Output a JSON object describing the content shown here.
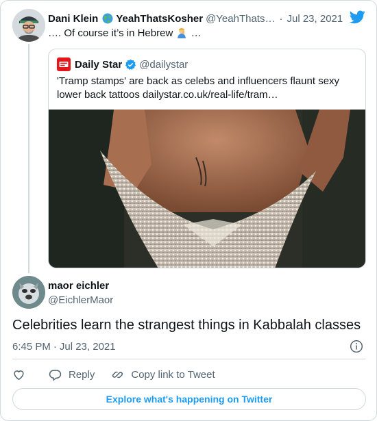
{
  "parent_tweet": {
    "author_name": "Dani Klein",
    "author_display2": "YeahThatsKosher",
    "author_handle": "@YeahThats…",
    "separator": "·",
    "date": "Jul 23, 2021",
    "text_before_emoji": "…. Of course it’s in Hebrew",
    "text_after_emoji": "…",
    "globe_icon": "globe-emoji",
    "emoji_icon": "man-facepalming-emoji"
  },
  "quoted_tweet": {
    "author_name": "Daily Star",
    "author_handle": "@dailystar",
    "text": "'Tramp stamps' are back as celebs and influencers flaunt sexy lower back tattoos dailystar.co.uk/real-life/tram…",
    "logo_icon": "daily-star-logo",
    "verified_icon": "verified-badge-icon",
    "image_description_icon": "photo"
  },
  "main_tweet": {
    "author_name": "maor eichler",
    "author_handle": "@EichlerMaor",
    "text": "Celebrities learn the strangest things in Kabbalah classes",
    "time": "6:45 PM",
    "separator": "·",
    "date": "Jul 23, 2021"
  },
  "actions": {
    "reply_label": "Reply",
    "copy_label": "Copy link to Tweet"
  },
  "explore_label": "Explore what's happening on Twitter",
  "colors": {
    "accent": "#1d9bf0",
    "muted_text": "#536471",
    "border": "#cfd9de",
    "daily_star_red": "#e3161b"
  }
}
